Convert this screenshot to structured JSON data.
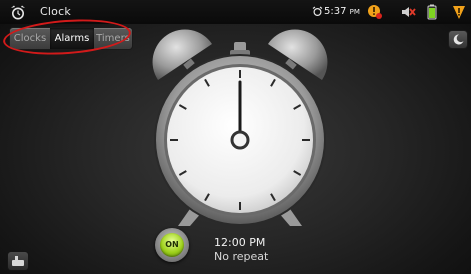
{
  "statusbar": {
    "app_title": "Clock",
    "time": "5:37",
    "ampm": "PM"
  },
  "tabs": [
    {
      "label": "Clocks",
      "selected": false
    },
    {
      "label": "Alarms",
      "selected": true
    },
    {
      "label": "Timers",
      "selected": false
    }
  ],
  "clock": {
    "hour": 12,
    "minute": 0
  },
  "alarm": {
    "toggle_label": "ON",
    "time": "12:00 PM",
    "repeat": "No repeat"
  },
  "icons": {
    "app": "alarm-clock-icon",
    "status_alarm": "alarm-clock-icon",
    "warning": "warning-icon",
    "mute": "speaker-muted-icon",
    "battery": "battery-icon",
    "notification": "alert-shield-icon",
    "night_mode": "crescent-moon-icon",
    "dock": "dock-icon"
  },
  "colors": {
    "annotation": "#d21a1a",
    "toggle_on": "#9fd21c",
    "warning": "#f2a21a"
  }
}
